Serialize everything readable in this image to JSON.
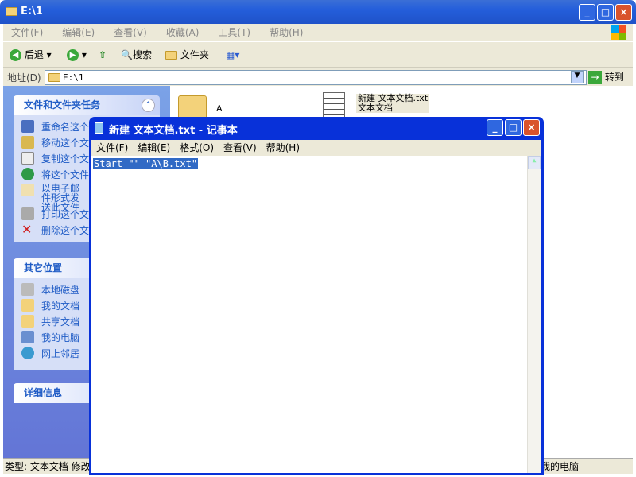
{
  "explorer": {
    "title": "E:\\1",
    "menu": [
      "文件(F)",
      "编辑(E)",
      "查看(V)",
      "收藏(A)",
      "工具(T)",
      "帮助(H)"
    ],
    "toolbar": {
      "back": "后退",
      "search": "搜索",
      "folders": "文件夹"
    },
    "address_label": "地址(D)",
    "address_value": "E:\\1",
    "go": "转到",
    "tasks": {
      "title": "文件和文件夹任务",
      "items": [
        "重命名这个文件",
        "移动这个文件",
        "复制这个文件",
        "将这个文件发布到 Web",
        "以电子邮件形式发送此文件",
        "打印这个文件",
        "删除这个文件"
      ]
    },
    "places": {
      "title": "其它位置",
      "items": [
        "本地磁盘",
        "我的文档",
        "共享文档",
        "我的电脑",
        "网上邻居"
      ]
    },
    "details": {
      "title": "详细信息"
    },
    "files": [
      {
        "name": "A"
      },
      {
        "name": "新建 文本文档.txt",
        "type": "文本文档"
      }
    ],
    "status_left": "类型: 文本文档 修改",
    "status_right": "我的电脑"
  },
  "notepad": {
    "title": "新建 文本文档.txt - 记事本",
    "menu": [
      "文件(F)",
      "编辑(E)",
      "格式(O)",
      "查看(V)",
      "帮助(H)"
    ],
    "content": "Start \"\" \"A\\B.txt\""
  }
}
